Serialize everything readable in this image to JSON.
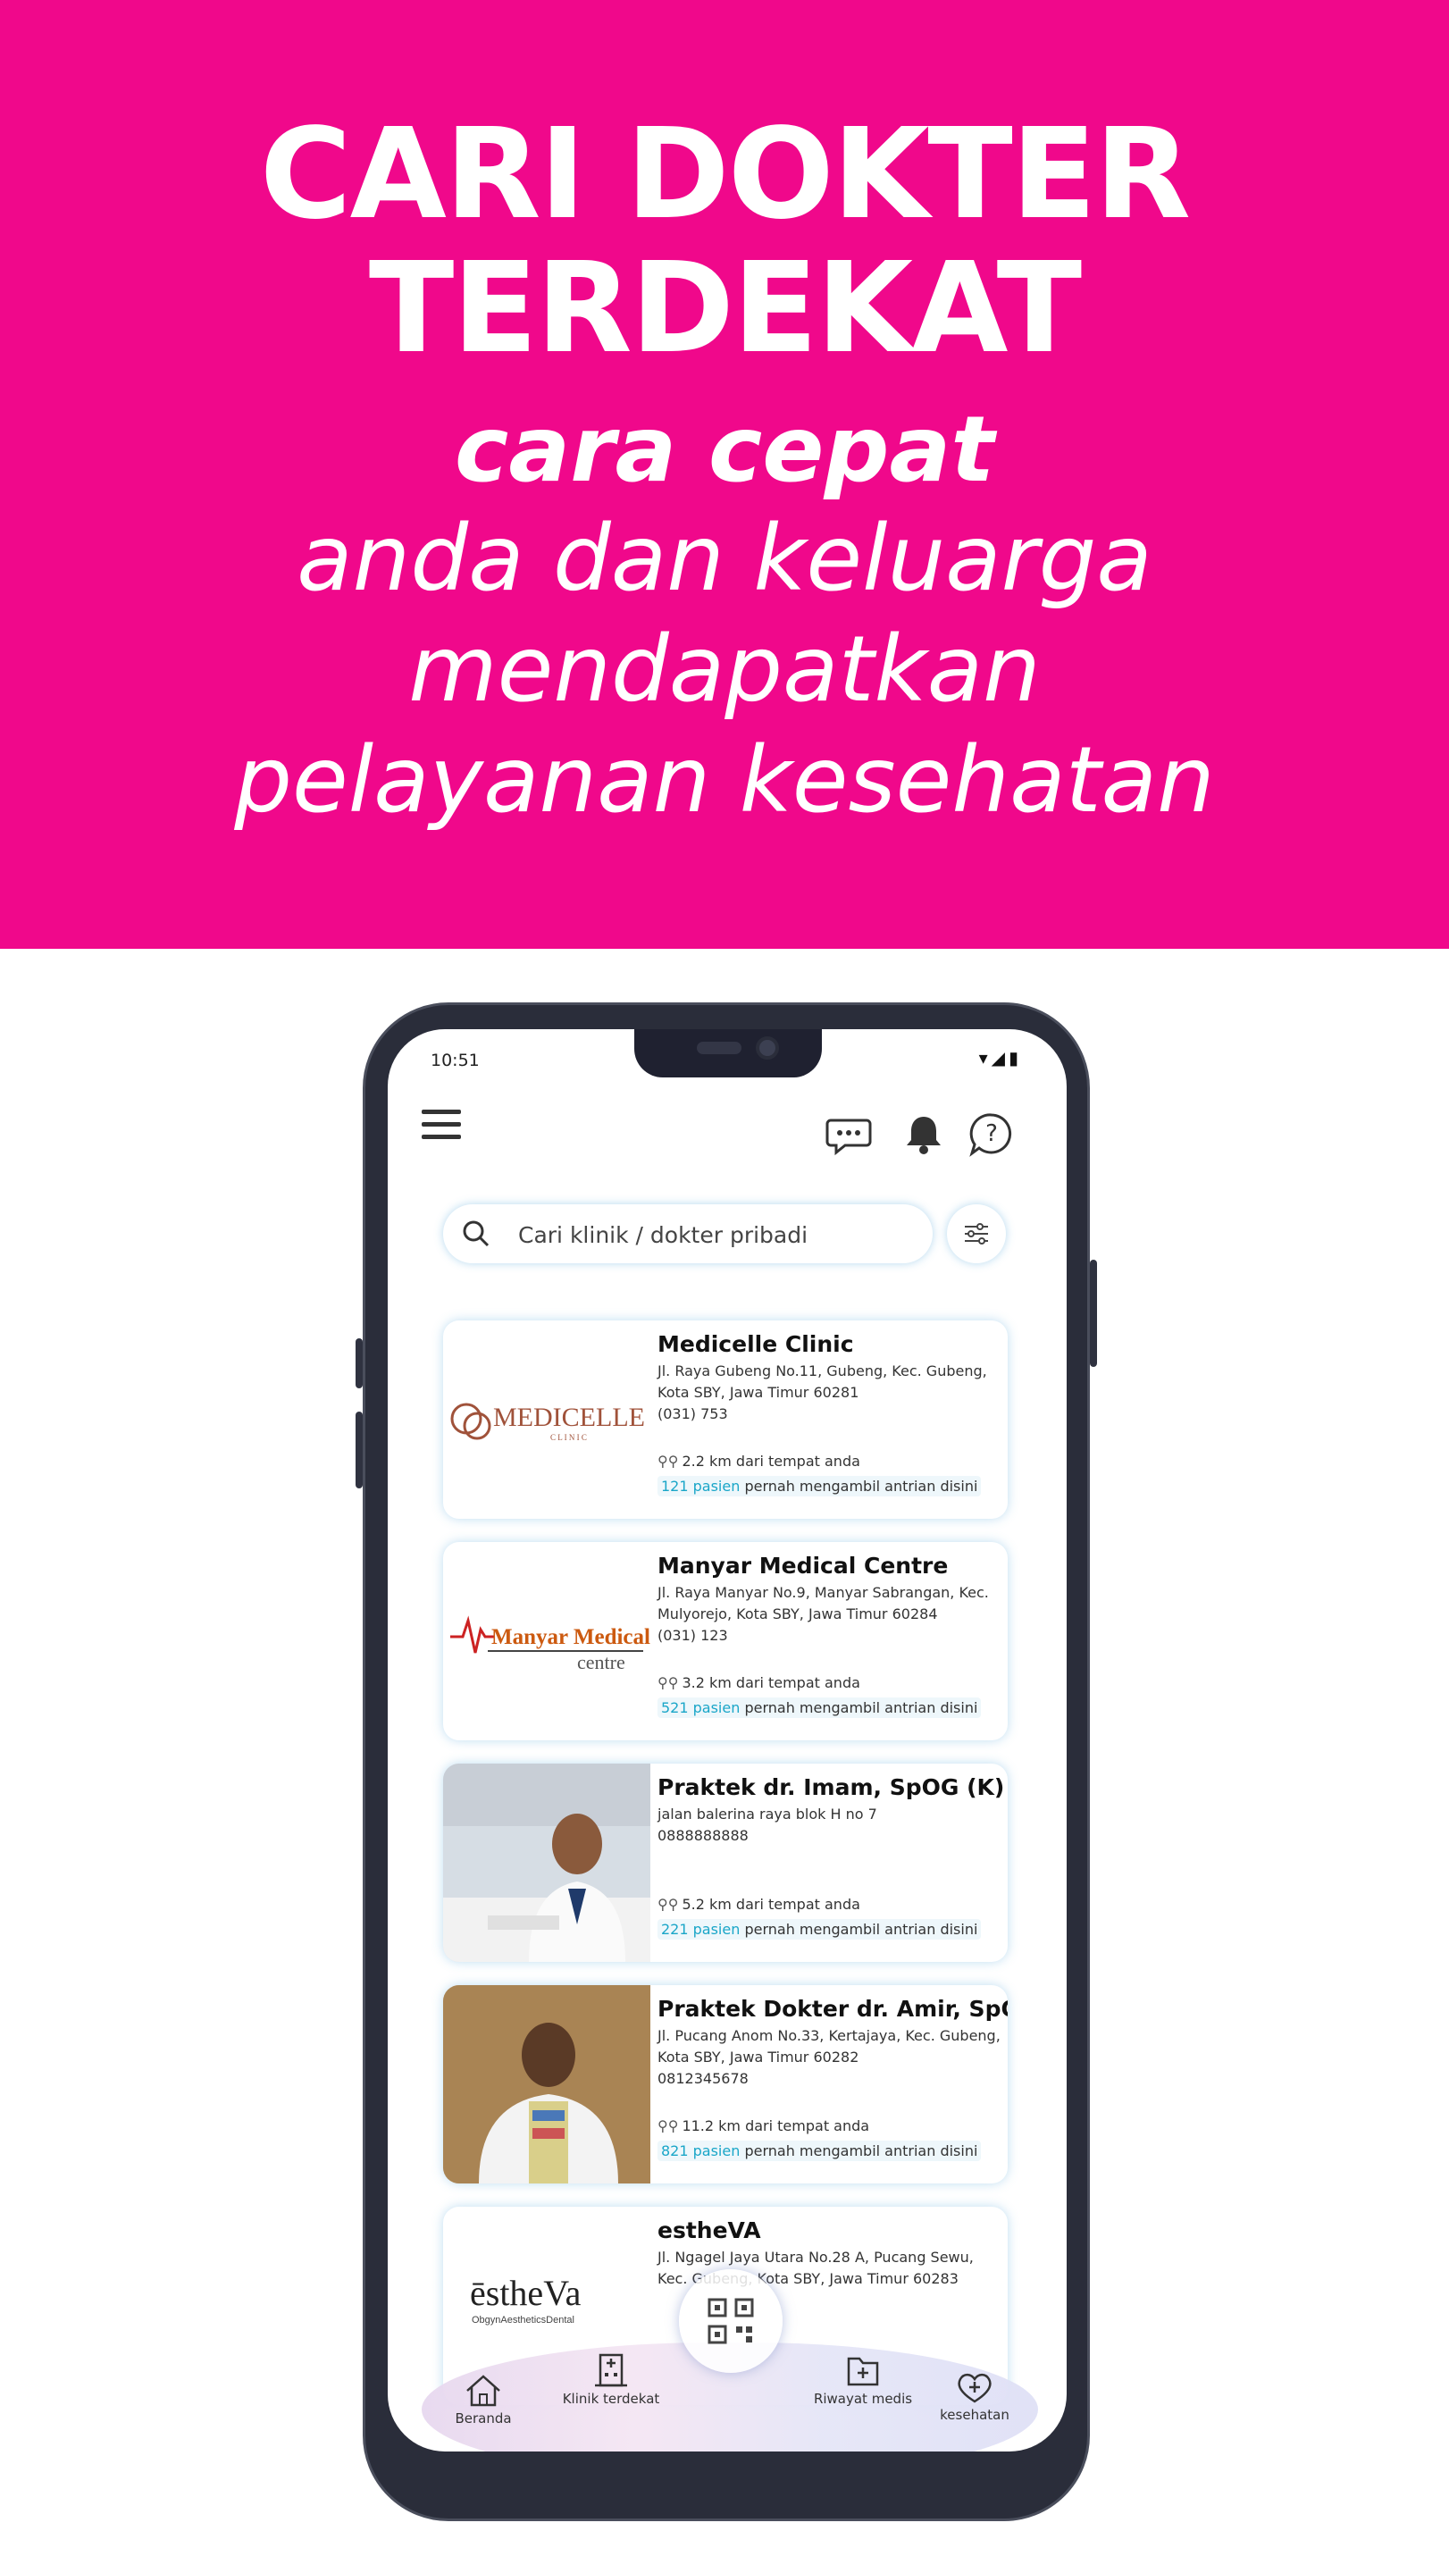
{
  "banner": {
    "title_line1": "CARI DOKTER",
    "title_line2": "TERDEKAT",
    "subtitle_bold": "cara cepat",
    "subtitle_line1": "anda dan keluarga",
    "subtitle_line2": "mendapatkan",
    "subtitle_line3": "pelayanan kesehatan",
    "background_color": "#f0088b"
  },
  "status_bar": {
    "time": "10:51",
    "icons": "▾◢▮"
  },
  "search": {
    "placeholder": "Cari klinik / dokter pribadi"
  },
  "clinics": [
    {
      "name": "Medicelle Clinic",
      "address": "Jl. Raya Gubeng No.11, Gubeng, Kec. Gubeng, Kota SBY, Jawa Timur 60281",
      "phone": "(031) 753",
      "distance": "2.2 km dari tempat anda",
      "patients": "121 pasien",
      "queue_text": "pernah mengambil antrian disini",
      "logo_text": "MEDICELLE",
      "logo_sub": "C L I N I C"
    },
    {
      "name": "Manyar Medical Centre",
      "address": "Jl. Raya Manyar No.9, Manyar Sabrangan, Kec. Mulyorejo, Kota SBY, Jawa Timur 60284",
      "phone": "(031) 123",
      "distance": "3.2 km dari tempat anda",
      "patients": "521 pasien",
      "queue_text": "pernah mengambil antrian disini",
      "logo_text": "Manyar Medical",
      "logo_sub": "centre"
    },
    {
      "name": "Praktek dr. Imam, SpOG (K)",
      "address": "jalan balerina raya blok H no 7",
      "phone": "0888888888",
      "distance": "5.2 km dari tempat anda",
      "patients": "221 pasien",
      "queue_text": "pernah mengambil antrian disini"
    },
    {
      "name": "Praktek Dokter dr. Amir, SpOG",
      "address": "Jl. Pucang Anom No.33, Kertajaya, Kec. Gubeng, Kota SBY, Jawa Timur 60282",
      "phone": "0812345678",
      "distance": "11.2 km dari tempat anda",
      "patients": "821 pasien",
      "queue_text": "pernah mengambil antrian disini"
    },
    {
      "name": "estheVA",
      "address": "Jl. Ngagel Jaya Utara No.28 A, Pucang Sewu, Kec. Gubeng, Kota SBY, Jawa Timur 60283",
      "logo_text": "ēstheVa",
      "logo_sub": "ObgynAestheticsDental"
    }
  ],
  "bottom_nav": {
    "items": [
      {
        "label": "Beranda",
        "icon": "home-icon"
      },
      {
        "label": "Klinik terdekat",
        "icon": "hospital-icon"
      },
      {
        "label": "Riwayat medis",
        "icon": "medical-folder-icon"
      },
      {
        "label": "kesehatan",
        "icon": "heart-plus-icon"
      }
    ],
    "center_icon": "qr-code-icon"
  },
  "colors": {
    "accent": "#1aa6c8",
    "brand_pink": "#f0088b"
  }
}
